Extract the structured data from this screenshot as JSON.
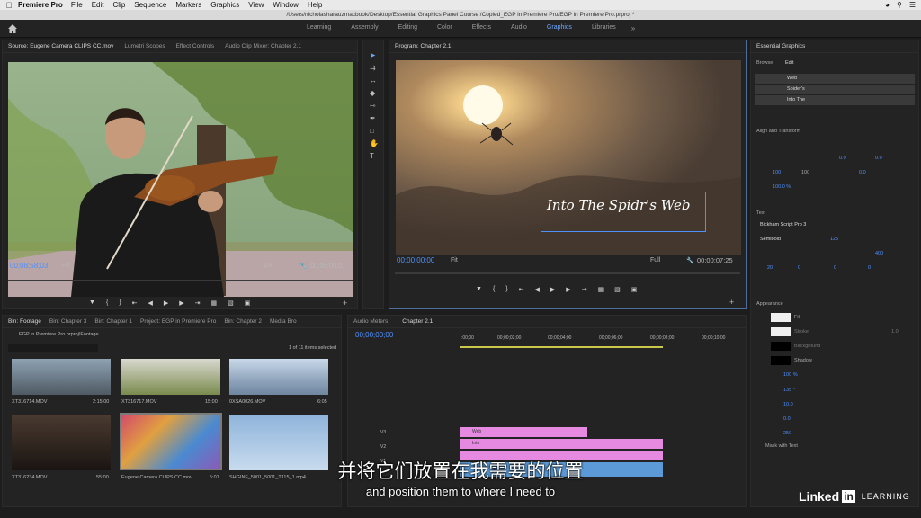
{
  "menubar": {
    "app_name": "Premiere Pro",
    "items": [
      "File",
      "Edit",
      "Clip",
      "Sequence",
      "Markers",
      "Graphics",
      "View",
      "Window",
      "Help"
    ]
  },
  "titlebar": {
    "path": "/Users/nicholasharauzmacbook/Desktop/Essential Graphics Panel Course /Copied_EGP in Premiere Pro/EGP in Premiere Pro.prproj *"
  },
  "workspace": {
    "tabs": [
      "Learning",
      "Assembly",
      "Editing",
      "Color",
      "Effects",
      "Audio",
      "Graphics",
      "Libraries"
    ],
    "active_tab": "Graphics"
  },
  "source": {
    "tabs": [
      "Source: Eugene Camera CLIPS CC.mov",
      "Lumetri Scopes",
      "Effect Controls",
      "Audio Clip Mixer: Chapter 2.1"
    ],
    "timecode": "00;08;58;03",
    "fit": "Fit",
    "resolution": "1/8",
    "duration": "00;00;05;01"
  },
  "program": {
    "tab": "Program: Chapter 2.1",
    "overlay_text": "Into The Spidr's Web",
    "timecode": "00;00;00;00",
    "fit": "Fit",
    "resolution": "Full",
    "duration": "00;00;07;25"
  },
  "essential_graphics": {
    "title": "Essential Graphics",
    "tabs": [
      "Browse",
      "Edit"
    ],
    "active_tab": "Edit",
    "layers": [
      "Web",
      "Spider's",
      "Into The"
    ],
    "align_title": "Align and Transform",
    "pos_x": "0.0",
    "pos_y": "0.0",
    "scale": "100",
    "scale_h": "100",
    "rotation": "0.0",
    "opacity": "100.0 %",
    "text_title": "Text",
    "font": "Bickham Script Pro 3",
    "font_style": "Semibold",
    "font_size": "125",
    "tracking": "400",
    "kerning": "20",
    "leading": "0",
    "baseline": "0",
    "tsume": "0",
    "appearance_title": "Appearance",
    "fill_label": "Fill",
    "stroke_label": "Stroke",
    "stroke_width": "1.0",
    "background_label": "Background",
    "shadow_label": "Shadow",
    "shadow_opacity": "100 %",
    "shadow_angle": "135 °",
    "shadow_distance": "10.0",
    "shadow_size": "0.0",
    "shadow_blur": "250",
    "mask_label": "Mask with Text"
  },
  "bin": {
    "tabs": [
      "Bin: Footage",
      "Bin: Chapter 3",
      "Bin: Chapter 1",
      "Project: EGP in Premiere Pro",
      "Bin: Chapter 2",
      "Media Bro"
    ],
    "path": "EGP in Premiere Pro.prproj\\Footage",
    "count": "1 of 11 items selected",
    "items": [
      {
        "name": "XT316714.MOV",
        "dur": "2:15:00"
      },
      {
        "name": "XT316717.MOV",
        "dur": "15:00"
      },
      {
        "name": "0XSA0026.MOV",
        "dur": "6:05"
      },
      {
        "name": "XT316234.MOV",
        "dur": "55:00"
      },
      {
        "name": "Eugene Camera CLIPS CC.mov",
        "dur": "5:01"
      },
      {
        "name": "SHGINF_5001_5001_T115_1.mp4",
        "dur": ""
      }
    ]
  },
  "timeline": {
    "tabs": [
      "Audio Meters",
      "Chapter 2.1"
    ],
    "timecode": "00;00;00;00",
    "ruler": [
      ":00;00",
      "00;00;02;00",
      "00;00;04;00",
      "00;00;06;00",
      "00;00;08;00",
      "00;00;10;00"
    ],
    "tracks": [
      "V3",
      "V2",
      "V1"
    ],
    "clips": [
      "Web",
      "Into"
    ]
  },
  "subtitle": {
    "cn": "并将它们放置在我需要的位置",
    "en": "and position them to where I need to"
  },
  "branding": {
    "word": "Linked",
    "in": "in",
    "learning": "LEARNING"
  }
}
